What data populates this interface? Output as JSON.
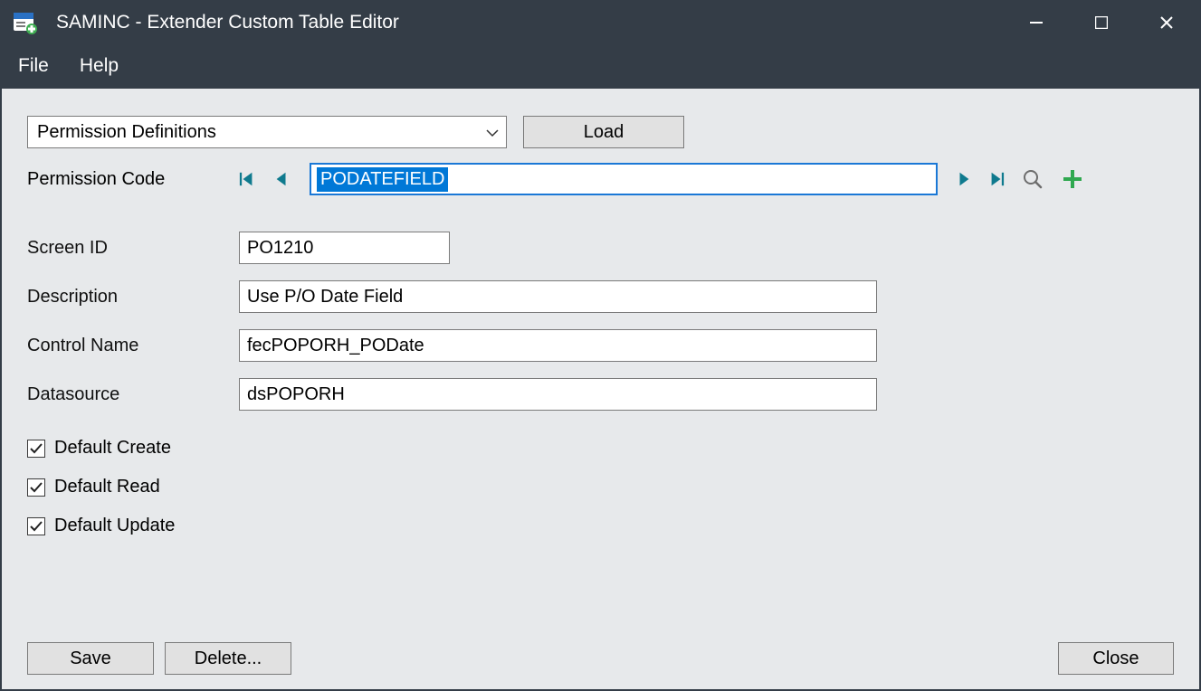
{
  "window": {
    "title": "SAMINC - Extender Custom Table Editor"
  },
  "menu": {
    "file": "File",
    "help": "Help"
  },
  "toolbar": {
    "dropdown_value": "Permission Definitions",
    "load_label": "Load"
  },
  "navigator": {
    "label": "Permission Code",
    "value": "PODATEFIELD"
  },
  "fields": {
    "screen_id": {
      "label": "Screen ID",
      "value": "PO1210"
    },
    "description": {
      "label": "Description",
      "value": "Use P/O Date Field"
    },
    "control_name": {
      "label": "Control Name",
      "value": "fecPOPORH_PODate"
    },
    "datasource": {
      "label": "Datasource",
      "value": "dsPOPORH"
    }
  },
  "checks": {
    "default_create": {
      "label": "Default Create",
      "checked": true
    },
    "default_read": {
      "label": "Default Read",
      "checked": true
    },
    "default_update": {
      "label": "Default Update",
      "checked": true
    }
  },
  "buttons": {
    "save": "Save",
    "delete": "Delete...",
    "close": "Close"
  },
  "colors": {
    "titlebar": "#343d47",
    "client": "#e7e9eb",
    "accent": "#1a78d6",
    "nav_arrow": "#0f7a8e",
    "plus": "#2fa84f"
  }
}
